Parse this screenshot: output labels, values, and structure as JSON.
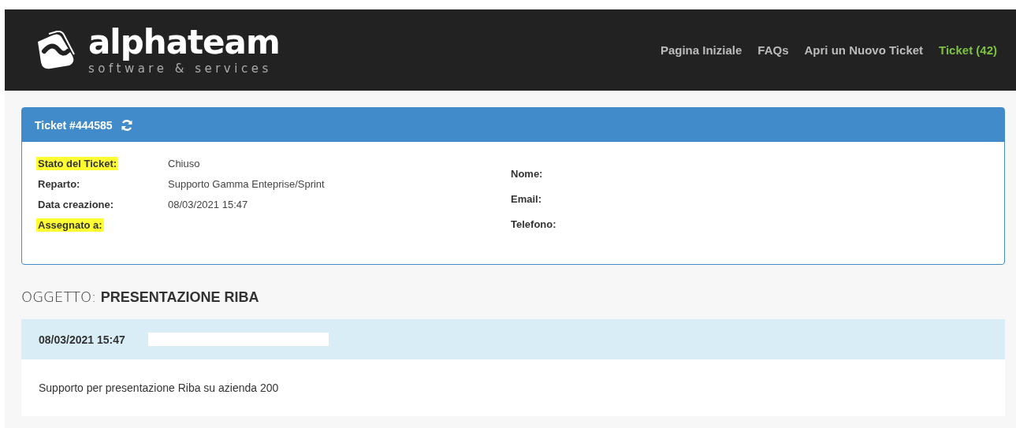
{
  "header": {
    "logo": {
      "name": "alphateam",
      "tagline": "software & services"
    },
    "nav": [
      {
        "label": "Pagina Iniziale",
        "selected": false
      },
      {
        "label": "FAQs",
        "selected": false
      },
      {
        "label": "Apri un Nuovo Ticket",
        "selected": false
      },
      {
        "label": "Ticket (42)",
        "selected": true
      }
    ]
  },
  "ticket": {
    "title": "Ticket #444585",
    "details": [
      {
        "label": "Stato del Ticket:",
        "value": "Chiuso",
        "highlighted": true
      },
      {
        "label": "Reparto:",
        "value": "Supporto Gamma Enteprise/Sprint",
        "highlighted": false
      },
      {
        "label": "Data creazione:",
        "value": "08/03/2021 15:47",
        "highlighted": false
      },
      {
        "label": "Assegnato a:",
        "highlighted": true
      }
    ],
    "contact": [
      {
        "label": "Nome:"
      },
      {
        "label": "Email:"
      },
      {
        "label": "Telefono:"
      }
    ]
  },
  "subject": {
    "prefix": "OGGETTO:",
    "text": "PRESENTAZIONE RIBA"
  },
  "messages": [
    {
      "date": "08/03/2021 15:47",
      "body": "Supporto per presentazione Riba su azienda 200"
    }
  ]
}
